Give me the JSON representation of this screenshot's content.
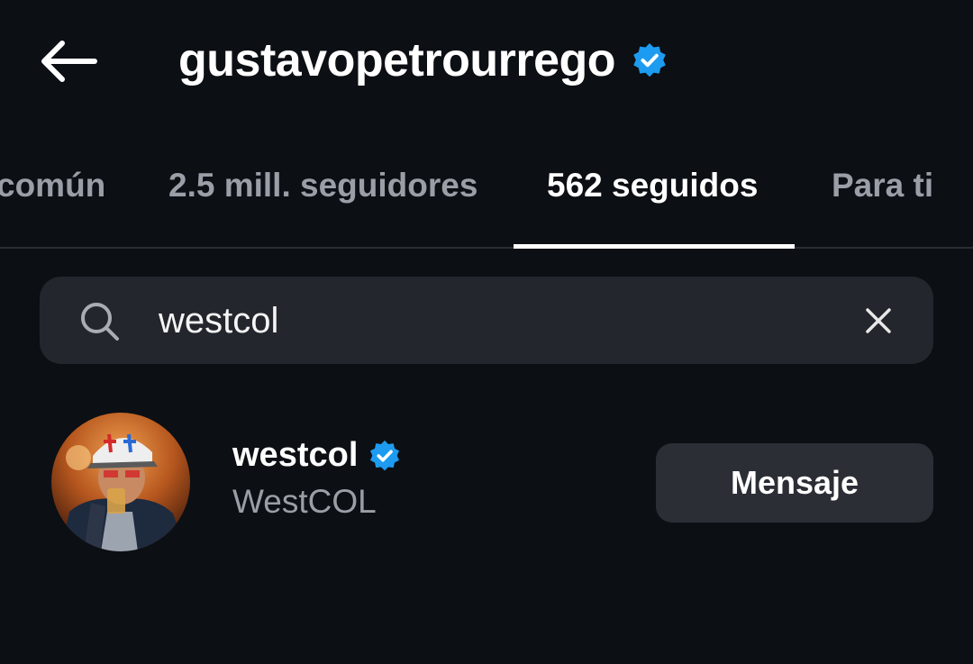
{
  "header": {
    "title": "gustavopetrourrego",
    "back_icon": "arrow-left-icon",
    "verified_icon": "verified-badge-icon"
  },
  "tabs": [
    {
      "label": "común",
      "active": false
    },
    {
      "label": "2.5 mill. seguidores",
      "active": false
    },
    {
      "label": "562 seguidos",
      "active": true
    },
    {
      "label": "Para ti",
      "active": false
    }
  ],
  "search": {
    "icon": "search-icon",
    "value": "westcol",
    "clear_icon": "close-icon"
  },
  "results": [
    {
      "username": "westcol",
      "full_name": "WestCOL",
      "verified": true,
      "button_label": "Mensaje"
    }
  ],
  "colors": {
    "background": "#0c0f14",
    "verified": "#1d9bf0",
    "muted_text": "#9a9ea6",
    "field_bg": "#23262c",
    "button_bg": "#2b2e35"
  }
}
